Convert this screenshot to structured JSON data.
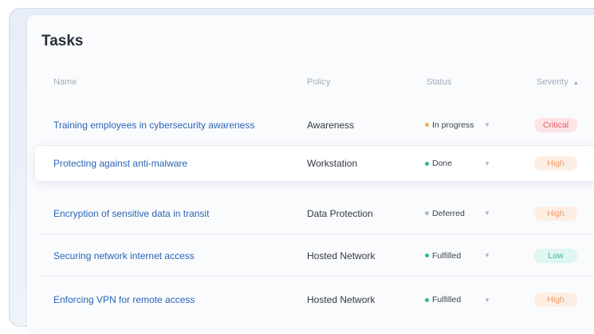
{
  "title": "Tasks",
  "columns": {
    "name": "Name",
    "policy": "Policy",
    "status": "Status",
    "severity": "Severity",
    "sort_icon": "sort-ascending-icon"
  },
  "colors": {
    "link": "#2a64b6",
    "in_progress": "#f2b33d",
    "done": "#2fb98c",
    "deferred": "#b4bbc6",
    "fulfilled": "#2fb98c",
    "critical_bg": "#fde4e6",
    "critical_fg": "#e45a66",
    "high_bg": "#fdeee4",
    "high_fg": "#f09a68",
    "low_bg": "#dff6f1",
    "low_fg": "#3fb59a"
  },
  "rows": [
    {
      "name": "Training employees in cybersecurity awareness",
      "policy": "Awareness",
      "status": "In progress",
      "severity": "Critical"
    },
    {
      "name": "Protecting against anti-malware",
      "policy": "Workstation",
      "status": "Done",
      "severity": "High"
    },
    {
      "name": "Encryption of sensitive data in transit",
      "policy": "Data Protection",
      "status": "Deferred",
      "severity": "High"
    },
    {
      "name": "Securing network internet access",
      "policy": "Hosted Network",
      "status": "Fulfilled",
      "severity": "Low"
    },
    {
      "name": "Enforcing VPN for remote access",
      "policy": "Hosted Network",
      "status": "Fulfilled",
      "severity": "High"
    }
  ]
}
